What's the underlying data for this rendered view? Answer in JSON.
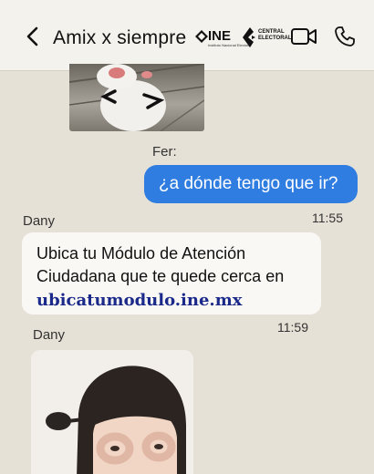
{
  "header": {
    "back_icon": "chevron-left-icon",
    "title": "Amix x siempre",
    "ine_logo_text": "INE",
    "ine_logo_subtext": "Instituto Nacional Electoral",
    "ce_logo_line1": "CENTRAL",
    "ce_logo_line2": "ELECTORAL",
    "video_icon": "video-camera-icon",
    "phone_icon": "phone-icon"
  },
  "messages": [
    {
      "type": "image",
      "from": "them",
      "description_icon": "kitten-photo"
    },
    {
      "type": "text",
      "from": "me",
      "sender": "Fer:",
      "text": "¿a dónde tengo que ir?"
    },
    {
      "type": "text",
      "from": "them",
      "sender": "Dany",
      "time": "11:55",
      "text": "Ubica tu Módulo de Atención Ciudadana que te quede cerca en",
      "link": "ubicatumodulo.ine.mx"
    },
    {
      "type": "image",
      "from": "them",
      "sender": "Dany",
      "time": "11:59",
      "description_icon": "child-photo"
    }
  ],
  "colors": {
    "background": "#e6e1d6",
    "header_bg": "#f4f2ec",
    "outgoing_bubble": "#2f7de1",
    "incoming_bubble": "#f9f8f5",
    "link": "#1b2a8a"
  }
}
